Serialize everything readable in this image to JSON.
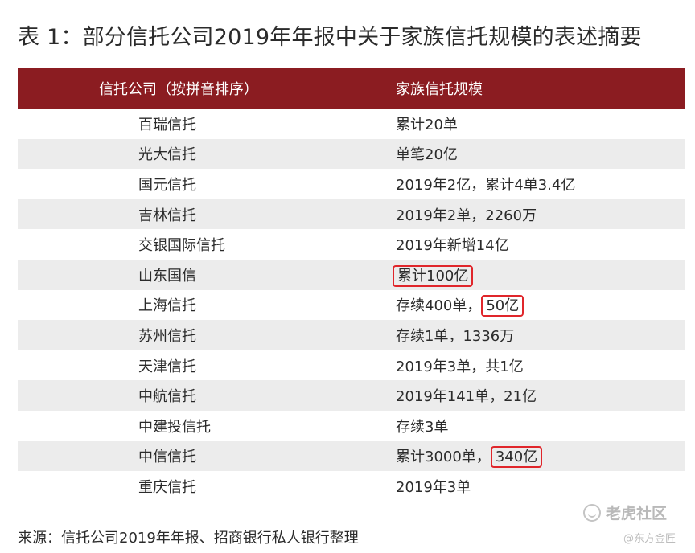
{
  "title": "表 1：部分信托公司2019年年报中关于家族信托规模的表述摘要",
  "table": {
    "headers": [
      "信托公司（按拼音排序）",
      "家族信托规模"
    ],
    "rows": [
      {
        "company": "百瑞信托",
        "scale": "累计20单"
      },
      {
        "company": "光大信托",
        "scale": "单笔20亿"
      },
      {
        "company": "国元信托",
        "scale": "2019年2亿，累计4单3.4亿"
      },
      {
        "company": "吉林信托",
        "scale": "2019年2单，2260万"
      },
      {
        "company": "交银国际信托",
        "scale": "2019年新增14亿"
      },
      {
        "company": "山东国信",
        "scale_box": "累计100亿"
      },
      {
        "company": "上海信托",
        "scale_pre": "存续400单，",
        "scale_box": "50亿"
      },
      {
        "company": "苏州信托",
        "scale": "存续1单，1336万"
      },
      {
        "company": "天津信托",
        "scale": "2019年3单，共1亿"
      },
      {
        "company": "中航信托",
        "scale": "2019年141单，21亿"
      },
      {
        "company": "中建投信托",
        "scale": "存续3单"
      },
      {
        "company": "中信信托",
        "scale_pre": "累计3000单，",
        "scale_box": "340亿"
      },
      {
        "company": "重庆信托",
        "scale": "2019年3单"
      }
    ]
  },
  "source": "来源：信托公司2019年年报、招商银行私人银行整理",
  "watermark": {
    "main": "老虎社区",
    "sub": "@东方金匠",
    "icon": "tiger-community-logo-icon"
  },
  "colors": {
    "header_bg": "#8b1c21",
    "highlight_border": "#e0262b",
    "stripe": "#ececec"
  }
}
